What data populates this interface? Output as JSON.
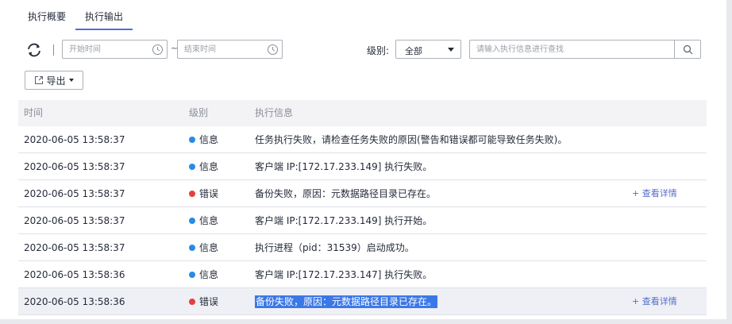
{
  "tabs": [
    {
      "label": "执行概要"
    },
    {
      "label": "执行输出"
    }
  ],
  "toolbar": {
    "start_placeholder": "开始时间",
    "separator": "~",
    "end_placeholder": "结束时间",
    "level_label": "级别:",
    "level_value": "全部",
    "search_placeholder": "请输入执行信息进行查找"
  },
  "export_label": "导出",
  "table": {
    "headers": {
      "time": "时间",
      "level": "级别",
      "message": "执行信息"
    },
    "rows": [
      {
        "time": "2020-06-05 13:58:37",
        "level": "信息",
        "message": "任务执行失败，请检查任务失败的原因(警告和错误都可能导致任务失败)。",
        "detail": ""
      },
      {
        "time": "2020-06-05 13:58:37",
        "level": "信息",
        "message": "客户端 IP:[172.17.233.149] 执行失败。",
        "detail": ""
      },
      {
        "time": "2020-06-05 13:58:37",
        "level": "错误",
        "message": "备份失败，原因：元数据路径目录已存在。",
        "detail": "+ 查看详情"
      },
      {
        "time": "2020-06-05 13:58:37",
        "level": "信息",
        "message": "客户端 IP:[172.17.233.149] 执行开始。",
        "detail": ""
      },
      {
        "time": "2020-06-05 13:58:37",
        "level": "信息",
        "message": "执行进程（pid：31539）启动成功。",
        "detail": ""
      },
      {
        "time": "2020-06-05 13:58:36",
        "level": "信息",
        "message": "客户端 IP:[172.17.233.147] 执行失败。",
        "detail": ""
      },
      {
        "time": "2020-06-05 13:58:36",
        "level": "错误",
        "message": "备份失败，原因：元数据路径目录已存在。",
        "detail": "+ 查看详情"
      }
    ]
  },
  "colors": {
    "info": "#2a8ae6",
    "error": "#e53e3e",
    "accent": "#526ecc"
  }
}
